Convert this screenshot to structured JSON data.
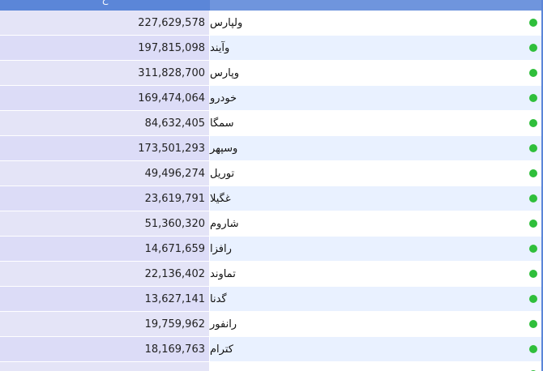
{
  "header": {
    "value_col_partial": "ح",
    "name_col": ""
  },
  "rows": [
    {
      "name": "ولپارس",
      "value": "227,629,578"
    },
    {
      "name": "وآیند",
      "value": "197,815,098"
    },
    {
      "name": "وپارس",
      "value": "311,828,700"
    },
    {
      "name": "خودرو",
      "value": "169,474,064"
    },
    {
      "name": "سمگا",
      "value": "84,632,405"
    },
    {
      "name": "وسپهر",
      "value": "173,501,293"
    },
    {
      "name": "توریل",
      "value": "49,496,274"
    },
    {
      "name": "غگیلا",
      "value": "23,619,791"
    },
    {
      "name": "شاروم",
      "value": "51,360,320"
    },
    {
      "name": "رافزا",
      "value": "14,671,659"
    },
    {
      "name": "تماوند",
      "value": "22,136,402"
    },
    {
      "name": "گدنا",
      "value": "13,627,141"
    },
    {
      "name": "رانفور",
      "value": "19,759,962"
    },
    {
      "name": "کترام",
      "value": "18,169,763"
    },
    {
      "name": "",
      "value": ""
    }
  ],
  "colors": {
    "header_left": "#5b86d8",
    "header_right": "#6f95dd",
    "status_dot": "#2fbf3b"
  },
  "icons": {
    "status": "green-dot-icon"
  }
}
